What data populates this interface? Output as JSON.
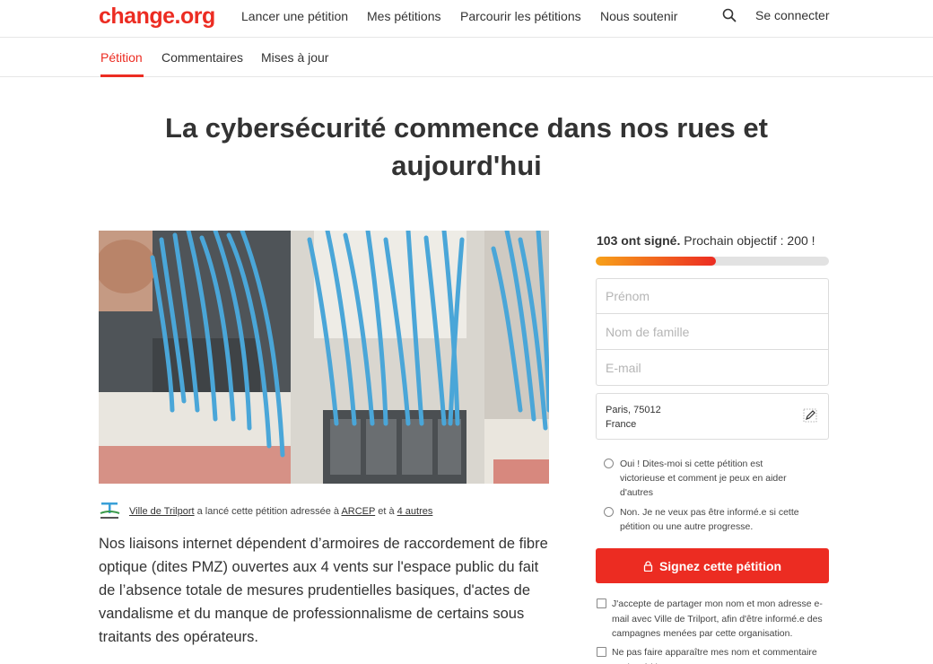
{
  "nav": {
    "logo": "change.org",
    "links": [
      "Lancer une pétition",
      "Mes pétitions",
      "Parcourir les pétitions",
      "Nous soutenir"
    ],
    "login": "Se connecter"
  },
  "subnav": {
    "tabs": [
      "Pétition",
      "Commentaires",
      "Mises à jour"
    ]
  },
  "petition": {
    "title": "La cybersécurité commence dans nos rues et aujourd'hui",
    "starter": {
      "name": "Ville de Trilport",
      "text_mid": " a lancé cette pétition adressée à ",
      "target": "ARCEP",
      "text_and": " et à ",
      "others": "4 autres"
    },
    "description": "Nos liaisons internet dépendent d’armoires de raccordement de fibre optique (dites PMZ) ouvertes aux 4 vents sur l'espace public du fait de l’absence totale de mesures prudentielles basiques, d'actes de vandalisme et du manque de professionnalisme de certains sous traitants des opérateurs."
  },
  "sidebar": {
    "signed_count": "103 ont signé.",
    "next_goal": " Prochain objectif : 200 !",
    "progress_fraction": 0.515,
    "form": {
      "first_name_placeholder": "Prénom",
      "last_name_placeholder": "Nom de famille",
      "email_placeholder": "E-mail"
    },
    "location": {
      "city": "Paris, 75012",
      "country": "France"
    },
    "radio_yes": "Oui ! Dites-moi si cette pétition est victorieuse et comment je peux en aider d'autres",
    "radio_no": "Non. Je ne veux pas être informé.e si cette pétition ou une autre progresse.",
    "sign_button": "Signez cette pétition",
    "checkbox_share": "J'accepte de partager mon nom et mon adresse e-mail avec Ville de Trilport, afin d'être informé.e des campagnes menées par cette organisation.",
    "checkbox_hide": "Ne pas faire apparaître mes nom et commentaire sur la pétition"
  },
  "colors": {
    "brand": "#ec2c22",
    "progress_start": "#f7a11a"
  },
  "icons": [
    "search-icon",
    "edit-location-icon",
    "lock-icon",
    "trilport-logo"
  ]
}
